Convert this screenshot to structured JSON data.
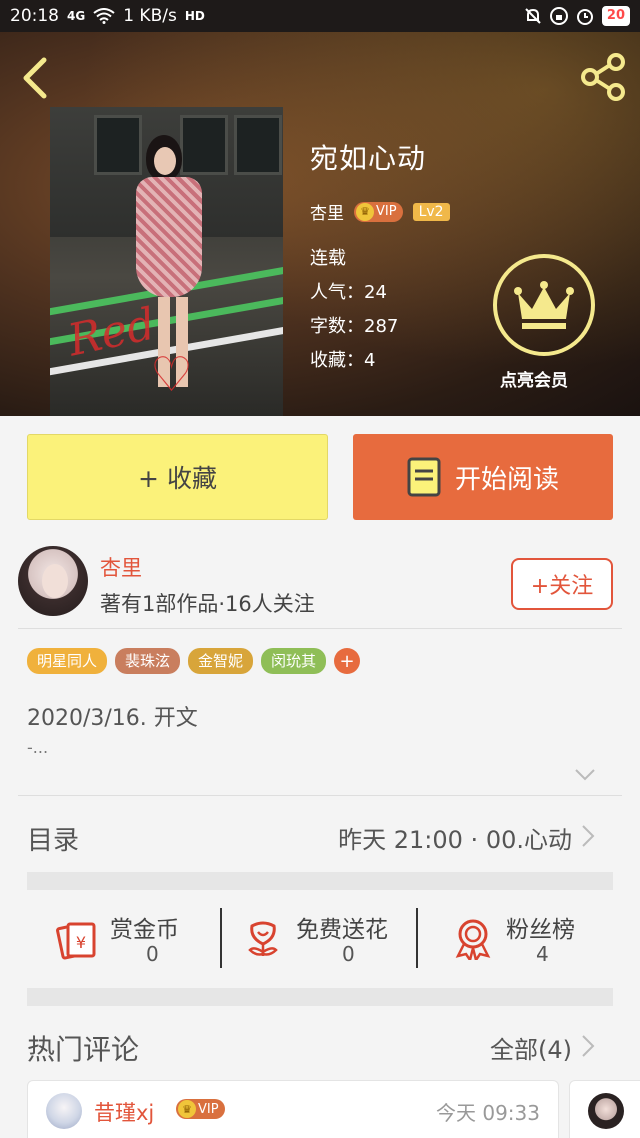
{
  "status_bar": {
    "time": "20:18",
    "network": "4G",
    "speed": "1 KB/s",
    "hd": "HD",
    "battery": "20"
  },
  "book": {
    "title": "宛如心动",
    "author": "杏里",
    "vip_label": "VIP",
    "level": "Lv2",
    "status": "连载",
    "popularity": "人气：24",
    "word_count": "字数：287",
    "favorites": "收藏：4",
    "member_label": "点亮会员"
  },
  "actions": {
    "collect": "+ 收藏",
    "read": "开始阅读"
  },
  "author_card": {
    "name": "杏里",
    "stats": "著有1部作品·16人关注",
    "follow": "+关注"
  },
  "tags": [
    {
      "label": "明星同人",
      "color": "#f0b13c"
    },
    {
      "label": "裴珠泫",
      "color": "#c97e5e"
    },
    {
      "label": "金智妮",
      "color": "#d8a53a"
    },
    {
      "label": "闵玧其",
      "color": "#8fbe57"
    }
  ],
  "tag_add": "+",
  "synopsis": {
    "text": "2020/3/16. 开文",
    "more": "-..."
  },
  "toc": {
    "label": "目录",
    "latest": "昨天 21:00 · 00.心动"
  },
  "stats": [
    {
      "label": "赏金币",
      "value": "0",
      "icon": "red-envelope-icon"
    },
    {
      "label": "免费送花",
      "value": "0",
      "icon": "flower-icon"
    },
    {
      "label": "粉丝榜",
      "value": "4",
      "icon": "ribbon-medal-icon"
    }
  ],
  "comments": {
    "title": "热门评论",
    "all": "全部(4)",
    "items": [
      {
        "name": "昔瑾xj",
        "vip": "VIP",
        "time": "今天 09:33"
      }
    ]
  },
  "colors": {
    "accent_orange": "#e76b3e",
    "accent_red": "#e2553b",
    "collect_yellow": "#fbf27a",
    "vip_gold": "#f5e98d"
  }
}
